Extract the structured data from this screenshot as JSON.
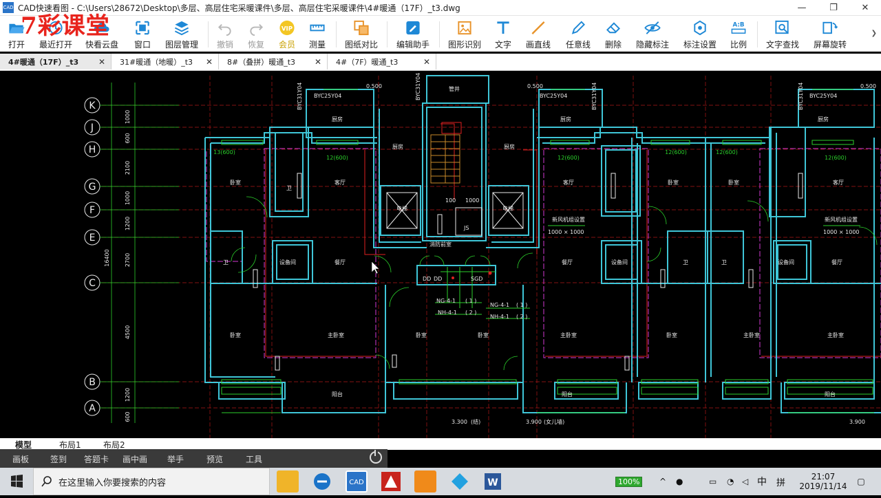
{
  "title": "CAD快速看图 - C:\\Users\\28672\\Desktop\\多层、高层住宅采暖课件\\多层、高层住宅采暖课件\\4#暖通（17F）_t3.dwg",
  "app_icon_text": "CAD",
  "window_controls": {
    "minimize": "—",
    "restore": "❐",
    "close": "✕"
  },
  "watermark": "7彩课堂",
  "toolbar": {
    "open": "打开",
    "recent": "最近打开",
    "cloud": "快看云盘",
    "window": "窗口",
    "layers": "图层管理",
    "undo": "撤销",
    "redo": "恢复",
    "vip": "会员",
    "measure": "测量",
    "compare": "图纸对比",
    "edit_assist": "编辑助手",
    "shape_recog": "图形识别",
    "text": "文字",
    "line": "画直线",
    "freeline": "任意线",
    "delete": "删除",
    "hide_dim": "隐藏标注",
    "dim_settings": "标注设置",
    "scale": "比例",
    "text_search": "文字查找",
    "rotate": "屏幕旋转"
  },
  "tabs": [
    {
      "label": "4#暖通（17F）_t3",
      "active": true
    },
    {
      "label": "31#暖通（地暖）_t3",
      "active": false
    },
    {
      "label": "8#（叠拼）暖通_t3",
      "active": false
    },
    {
      "label": "4#（7F）暖通_t3",
      "active": false
    }
  ],
  "tab_close": "✕",
  "drawing": {
    "grid_axes": [
      "K",
      "J",
      "H",
      "G",
      "F",
      "E",
      "C",
      "B",
      "A"
    ],
    "dims": [
      "1000",
      "600",
      "2100",
      "1000",
      "1200",
      "2700",
      "4500",
      "1200",
      "600"
    ],
    "total_dim": "16400",
    "rooms": {
      "living": "客厅",
      "bedroom": "卧室",
      "master": "主卧室",
      "kitchen": "厨房",
      "bath": "卫",
      "dining": "餐厅",
      "balcony": "阳台",
      "stair": "楼梯",
      "elevator": "电梯",
      "corridor": "前室",
      "shaft": "管井",
      "dumb": "设备间"
    },
    "labels": {
      "byc_left": "BYC25Y04",
      "byc_right": "BYC25Y04",
      "byc_vert": "BYC31Y04",
      "elev_0500": "0.500",
      "r12a": "12(600)",
      "r13": "13(600)",
      "r12b": "12(600)",
      "r12c": "12(600)",
      "r12d": "12(600)",
      "vent1": "新风机组设置",
      "vent2": "新风机组设置",
      "size1": "1000 × 1000",
      "size2": "1000 × 1000",
      "sz100": "100",
      "sz1000": "1000",
      "js": "JS",
      "fire": "消防前室",
      "ng1": "NG-4-1",
      "nh1": "NH-4-1",
      "ng2": "NG-4-1",
      "nh2": "NH-4-1",
      "n1": "( 1 )",
      "n2": "( 2 )",
      "n3": "( 1 )",
      "n4": "( 2 )",
      "elev1": "3.300",
      "elev2": "3.900",
      "elev3": "3.900",
      "note1": "(结)",
      "note2": "(女儿墙)",
      "sgd": "SGD",
      "dd1": "DD",
      "dd2": "DD"
    }
  },
  "layout_tabs": [
    "模型",
    "布局1",
    "布局2"
  ],
  "floatbar": [
    "画板",
    "签到",
    "答题卡",
    "画中画",
    "举手",
    "预览",
    "工具"
  ],
  "taskbar": {
    "search_placeholder": "在这里输入你要搜索的内容",
    "battery": "100%",
    "ime_lang": "中",
    "ime_mode": "拼",
    "time": "21:07",
    "date": "2019/11/14",
    "cad_label": "CAD"
  }
}
